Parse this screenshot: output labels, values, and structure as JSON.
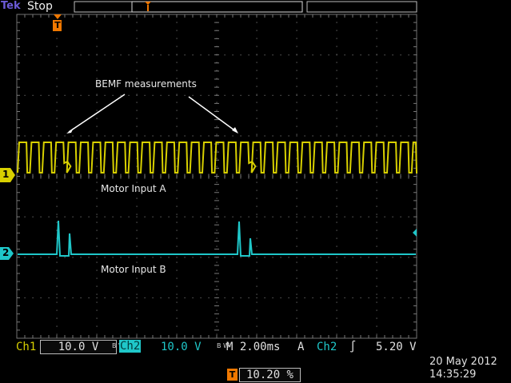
{
  "header": {
    "brand": "Tek",
    "run_state": "Stop",
    "trigger_marker": "T"
  },
  "annotations": {
    "bemf": "BEMF measurements",
    "motor_a": "Motor Input A",
    "motor_b": "Motor Input B"
  },
  "channels": {
    "ch1_marker": "1",
    "ch2_marker": "2"
  },
  "footer": {
    "ch1_label": "Ch1",
    "ch1_scale": "10.0 V",
    "bw1": "B W",
    "ch2_label": "Ch2",
    "ch2_scale": "10.0 V",
    "bw2": "B W",
    "timebase": "M 2.00ms",
    "acq_label": "A",
    "trig_source": "Ch2",
    "trig_slope": "∫",
    "trig_level": "5.20 V",
    "trig_pos_icon": "T",
    "trig_pos": "10.20 %",
    "date": "20 May 2012",
    "time": "14:35:29"
  },
  "colors": {
    "ch1": "#d8d000",
    "ch2": "#1fc7c9",
    "grid": "#6a6a6a",
    "accent": "#f07800"
  }
}
